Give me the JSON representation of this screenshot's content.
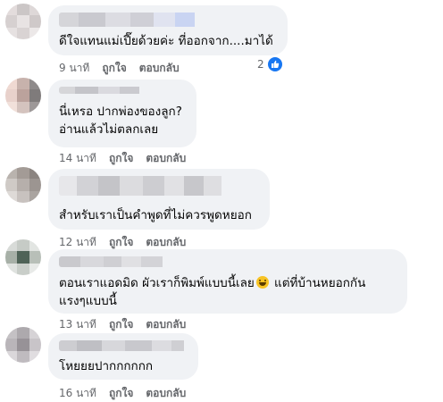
{
  "comments": [
    {
      "text_lines": [
        "ดีใจแทนแม่เปี๊ยด้วยค่ะ ที่ออกจาก....มาได้"
      ],
      "time": "9 นาที",
      "like_label": "ถูกใจ",
      "reply_label": "ตอบกลับ",
      "reaction_count": "2"
    },
    {
      "text_lines": [
        "นี่เหรอ ปากพ่องของลูก?",
        "อ่านแล้วไม่ตลกเลย"
      ],
      "time": "14 นาที",
      "like_label": "ถูกใจ",
      "reply_label": "ตอบกลับ"
    },
    {
      "text_lines": [
        "สำหรับเราเป็นคำพูดที่ไม่ควรพูดหยอก"
      ],
      "time": "12 นาที",
      "like_label": "ถูกใจ",
      "reply_label": "ตอบกลับ"
    },
    {
      "text_line1_before": "ตอนเราแอดมิด ผัวเราก็พิมพ์แบบนี้เลย",
      "text_line1_after": " แต่ที่บ้านหยอกกัน",
      "text_line2": "แรงๆแบบนี้",
      "emoji": "grinning-sweat-emoji",
      "time": "13 นาที",
      "like_label": "ถูกใจ",
      "reply_label": "ตอบกลับ"
    },
    {
      "text_lines": [
        "โหยยยปากกกกกก"
      ],
      "time": "16 นาที",
      "like_label": "ถูกใจ",
      "reply_label": "ตอบกลับ"
    }
  ],
  "colors": {
    "bubble": "#f0f2f5",
    "meta_text": "#65676b",
    "like_blue": "#1877f2"
  }
}
